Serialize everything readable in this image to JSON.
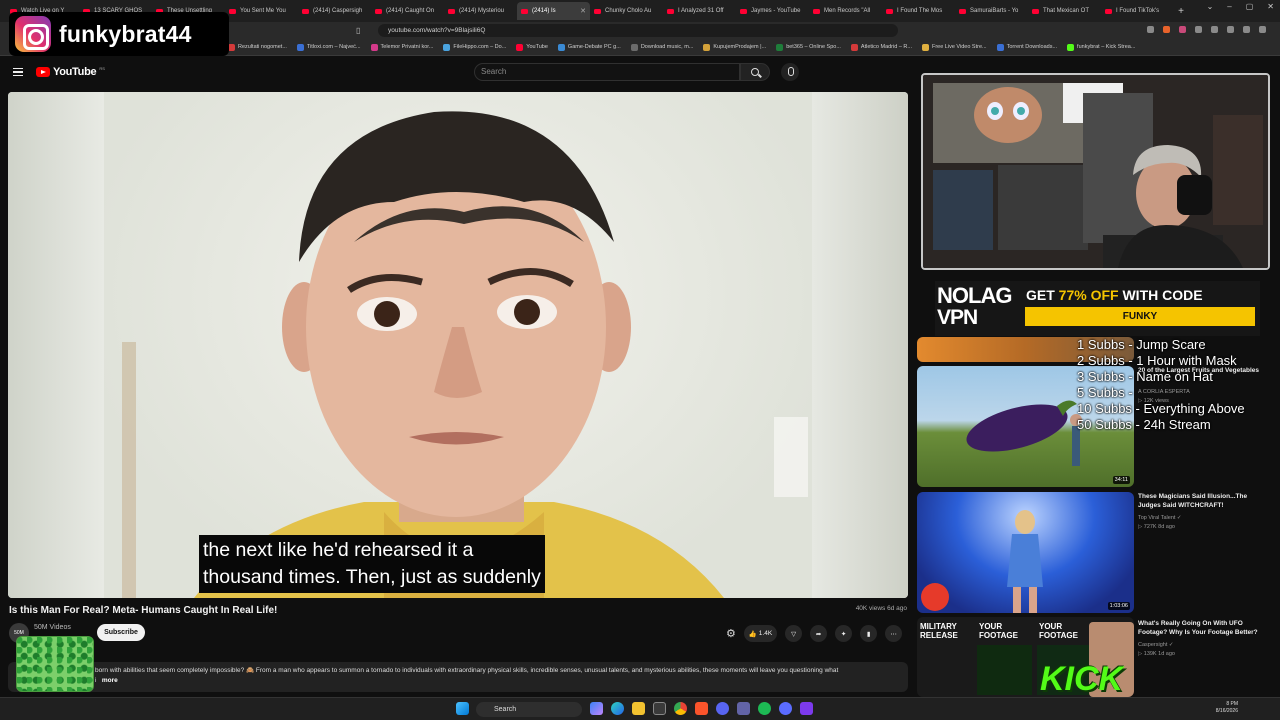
{
  "browser": {
    "tabs": [
      {
        "label": "Watch Live on Y",
        "active": false
      },
      {
        "label": "13 SCARY GHOS",
        "active": false
      },
      {
        "label": "These Unsettling",
        "active": false
      },
      {
        "label": "You Sent Me You",
        "active": false
      },
      {
        "label": "(2414) Caspersigh",
        "active": false
      },
      {
        "label": "(2414) Caught On",
        "active": false
      },
      {
        "label": "(2414) Mysteriou",
        "active": false
      },
      {
        "label": "(2414) Is",
        "active": true
      },
      {
        "label": "Chunky Cholo Au",
        "active": false
      },
      {
        "label": "I Analyzed 31 Off",
        "active": false
      },
      {
        "label": "Jaymes - YouTube",
        "active": false
      },
      {
        "label": "Men Records \"All",
        "active": false
      },
      {
        "label": "I Found The Mos",
        "active": false
      },
      {
        "label": "SamuraiBarts - Yo",
        "active": false
      },
      {
        "label": "That Mexican OT",
        "active": false
      },
      {
        "label": "I Found TikTok's",
        "active": false
      }
    ],
    "new_tab": "+",
    "window_controls": [
      "⌄",
      "–",
      "▢",
      "✕"
    ],
    "url": "youtube.com/watch?v=9Blajsili6Q",
    "bookmarks": [
      {
        "label": "Rezultati nogomet...",
        "color": "#d43a3a"
      },
      {
        "label": "Titloxi.com – Najveć...",
        "color": "#3a6fd4"
      },
      {
        "label": "Telemor Privatni kor...",
        "color": "#d43a8a"
      },
      {
        "label": "FileHippo.com – Do...",
        "color": "#4aa3df"
      },
      {
        "label": "YouTube",
        "color": "#ff0033"
      },
      {
        "label": "Game-Debate PC g...",
        "color": "#3a8ad4"
      },
      {
        "label": "Download music, m...",
        "color": "#6b6b6b"
      },
      {
        "label": "KupujemProdajem |...",
        "color": "#d4a23a"
      },
      {
        "label": "bet365 – Online Spo...",
        "color": "#1e7d3a"
      },
      {
        "label": "Atletico Madrid – R...",
        "color": "#d43a3a"
      },
      {
        "label": "Free Live Video Stre...",
        "color": "#e0b040"
      },
      {
        "label": "Torrent Downloads...",
        "color": "#3a6fd4"
      },
      {
        "label": "funkybrat – Kick Strea...",
        "color": "#53fc18"
      }
    ]
  },
  "overlay": {
    "instagram_handle": "funkybrat44",
    "promo_brand_top": "NOLAG",
    "promo_brand_bottom": "VPN",
    "promo_text_a": "GET ",
    "promo_text_b": "77% OFF",
    "promo_text_c": " WITH CODE",
    "promo_code": "FUNKY",
    "sub_goals": [
      "1 Subbs - Jump Scare",
      "2 Subbs - 1 Hour with Mask",
      "3 Subbs - Name on Hat",
      "5 Subbs -",
      "10 Subbs - Everything Above",
      "50 Subbs - 24h Stream"
    ],
    "kick_brand": "KICK FUNKYBRAT"
  },
  "youtube": {
    "logo": "YouTube",
    "logo_country": "RS",
    "search_placeholder": "Search",
    "video": {
      "subtitle_line1": "the next like he'd rehearsed it a",
      "subtitle_line2": "thousand times. Then, just as suddenly",
      "title": "Is this Man For Real? Meta- Humans Caught In Real Life!",
      "views_age": "40K views  6d ago",
      "channel_avatar_text": "50M",
      "channel_subs": "50M Videos",
      "subscribe_label": "Subscribe",
      "like_count": "1.4K",
      "description": "born with abilities that seem completely impossible? 🙈 From a man who appears to summon a tornado to individuals with extraordinary physical skills, incredible senses, unusual talents, and mysterious abilities, these moments will leave you questioning what",
      "description_tail": "i",
      "more_label": "more"
    },
    "related": [
      {
        "title": "20 of the Largest Fruits and Vegetables",
        "channel": "A CORLIA ESPERTA",
        "meta": "▷ 12K views",
        "duration": "34:11"
      },
      {
        "title": "These Magicians Said Illusion...The Judges Said WITCHCRAFT!",
        "channel": "Top Viral Talent ✓",
        "meta": "▷ 727K  8d ago",
        "duration": "1:03:06"
      },
      {
        "title": "What's Really Going On With UFO Footage? Why Is Your Footage Better?",
        "channel": "Caspersight ✓",
        "meta": "▷ 139K  1d ago",
        "duration": "",
        "badges": [
          "MILITARY RELEASE",
          "YOUR FOOTAGE",
          "YOUR FOOTAGE"
        ]
      }
    ]
  },
  "taskbar": {
    "search_label": "Search",
    "clock_time": "8 PM",
    "clock_date": "8/16/2026"
  },
  "colors": {
    "youtube_red": "#ff0000",
    "kick_green": "#53fc18",
    "promo_yellow": "#f5c400",
    "background": "#0f0f0f"
  }
}
